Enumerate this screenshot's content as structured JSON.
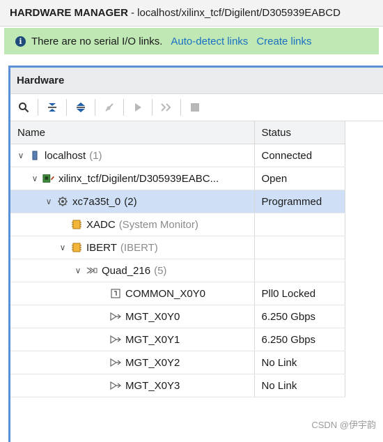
{
  "titlebar": {
    "title": "HARDWARE MANAGER",
    "path": "- localhost/xilinx_tcf/Digilent/D305939EABCD"
  },
  "banner": {
    "message": "There are no serial I/O links.",
    "auto_detect": "Auto-detect links",
    "create": "Create links",
    "info_glyph": "i",
    "color": "#bfe8b4"
  },
  "panel": {
    "title": "Hardware",
    "toolbar": [
      {
        "name": "search-icon"
      },
      {
        "name": "collapse-all-icon"
      },
      {
        "name": "expand-all-icon"
      },
      {
        "name": "disconnect-icon"
      },
      {
        "name": "run-icon"
      },
      {
        "name": "step-icon"
      },
      {
        "name": "stop-icon"
      }
    ]
  },
  "columns": {
    "name": "Name",
    "status": "Status"
  },
  "tree": [
    {
      "name": "localhost",
      "extra": "(1)",
      "status": "Connected",
      "icon": "server-icon",
      "expand": "v"
    },
    {
      "name": "xilinx_tcf/Digilent/D305939EABC...",
      "extra": "",
      "status": "Open",
      "icon": "board-icon",
      "expand": "v"
    },
    {
      "name": "xc7a35t_0",
      "extra": "(2)",
      "status": "Programmed",
      "icon": "chip-icon",
      "expand": "v"
    },
    {
      "name": "XADC",
      "extra": "(System Monitor)",
      "status": "",
      "icon": "ip-core-icon",
      "expand": ""
    },
    {
      "name": "IBERT",
      "extra": "(IBERT)",
      "status": "",
      "icon": "ip-core-icon",
      "expand": "v"
    },
    {
      "name": "Quad_216",
      "extra": "(5)",
      "status": "",
      "icon": "quad-icon",
      "expand": "v"
    },
    {
      "name": "COMMON_X0Y0",
      "extra": "",
      "status": "Pll0 Locked",
      "icon": "common-icon",
      "expand": ""
    },
    {
      "name": "MGT_X0Y0",
      "extra": "",
      "status": "6.250 Gbps",
      "icon": "mgt-icon",
      "expand": ""
    },
    {
      "name": "MGT_X0Y1",
      "extra": "",
      "status": "6.250 Gbps",
      "icon": "mgt-icon",
      "expand": ""
    },
    {
      "name": "MGT_X0Y2",
      "extra": "",
      "status": "No Link",
      "icon": "mgt-icon",
      "expand": ""
    },
    {
      "name": "MGT_X0Y3",
      "extra": "",
      "status": "No Link",
      "icon": "mgt-icon",
      "expand": ""
    }
  ],
  "selected_row": "xc7a35t_0",
  "watermark": "CSDN @伊宇韵"
}
